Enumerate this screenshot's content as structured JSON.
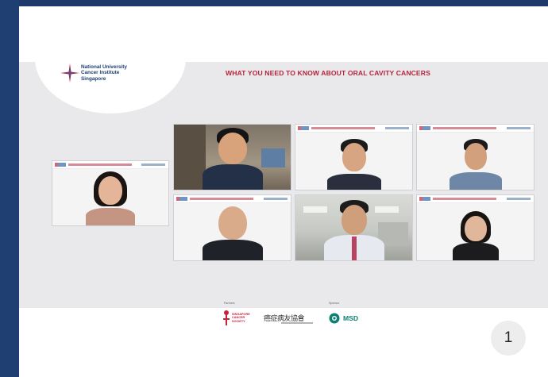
{
  "slide": {
    "logo_lines": [
      "National University",
      "Cancer Institute",
      "Singapore"
    ],
    "title": "WHAT YOU NEED TO KNOW ABOUT ORAL CAVITY CANCERS"
  },
  "participants": [
    {
      "id": "moderator",
      "view": "slide-background"
    },
    {
      "id": "panelist-1",
      "view": "camera"
    },
    {
      "id": "panelist-2",
      "view": "slide-background"
    },
    {
      "id": "panelist-3",
      "view": "slide-background"
    },
    {
      "id": "panelist-4",
      "view": "slide-background"
    },
    {
      "id": "panelist-5",
      "view": "camera"
    },
    {
      "id": "panelist-6",
      "view": "slide-background"
    }
  ],
  "sponsors": {
    "label_partners": "Partners",
    "label_sponsor": "Sponsor",
    "singapore_cancer_society": [
      "SINGAPORE",
      "CANCER",
      "SOCIETY"
    ],
    "chinese_logo": "癌症病友協會",
    "msd": "MSD"
  },
  "page_number": "1",
  "colors": {
    "frame": "#1f3e72",
    "title_red": "#b8233a",
    "msd_teal": "#0f7f73"
  }
}
